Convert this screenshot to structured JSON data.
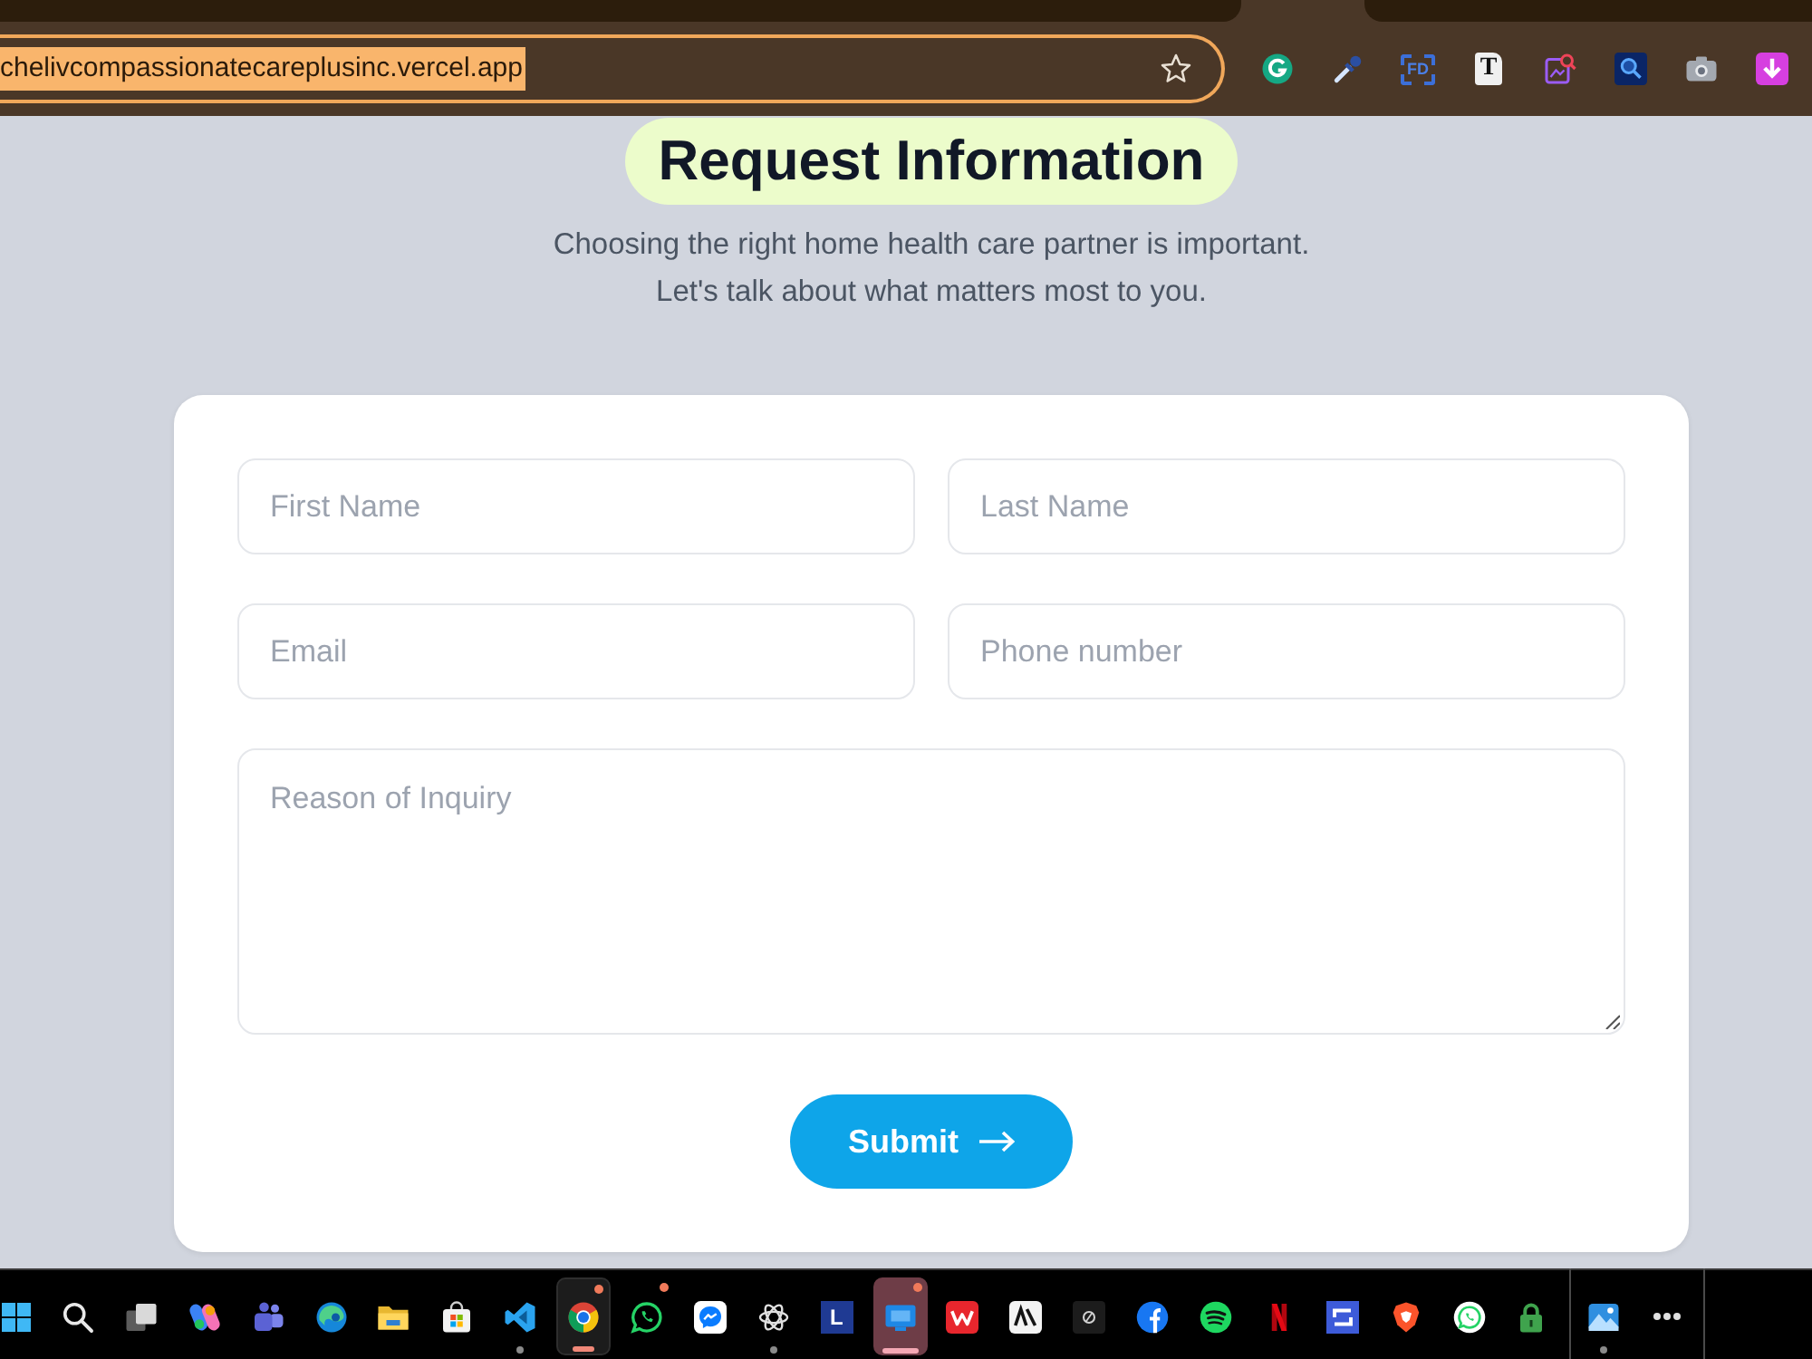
{
  "browser": {
    "address": {
      "url": "chelivcompassionatecareplusinc.vercel.app",
      "focused": true,
      "url_selected": true
    },
    "extension_labels": [
      "FD",
      "T"
    ]
  },
  "header": {
    "title": "Request Information",
    "subtitle_lines": [
      "Choosing the right home health care partner is important.",
      "Let's talk about what matters most to you."
    ]
  },
  "form": {
    "fields": [
      {
        "kind": "input",
        "placeholder": "First Name"
      },
      {
        "kind": "input",
        "placeholder": "Last Name"
      },
      {
        "kind": "input",
        "placeholder": "Email"
      },
      {
        "kind": "input",
        "placeholder": "Phone number"
      },
      {
        "kind": "textarea",
        "placeholder": "Reason of Inquiry"
      }
    ],
    "submit": {
      "label": "Submit"
    }
  },
  "taskbar": {
    "apps": [
      {
        "open": false,
        "selected": false,
        "attention": false,
        "notification": false
      },
      {
        "open": false,
        "selected": false,
        "attention": false,
        "notification": false
      },
      {
        "open": false,
        "selected": false,
        "attention": false,
        "notification": false
      },
      {
        "open": false,
        "selected": false,
        "attention": false,
        "notification": false
      },
      {
        "open": false,
        "selected": false,
        "attention": false,
        "notification": false
      },
      {
        "open": false,
        "selected": false,
        "attention": false,
        "notification": false
      },
      {
        "open": false,
        "selected": false,
        "attention": false,
        "notification": false
      },
      {
        "open": false,
        "selected": false,
        "attention": false,
        "notification": false
      },
      {
        "open": true,
        "selected": false,
        "attention": false,
        "notification": false
      },
      {
        "open": true,
        "selected": true,
        "attention": false,
        "notification": true
      },
      {
        "open": false,
        "selected": false,
        "attention": false,
        "notification": true
      },
      {
        "open": false,
        "selected": false,
        "attention": false,
        "notification": false
      },
      {
        "open": true,
        "selected": false,
        "attention": false,
        "notification": false
      },
      {
        "open": false,
        "selected": false,
        "attention": false,
        "notification": false,
        "label": "L"
      },
      {
        "open": true,
        "selected": false,
        "attention": true,
        "notification": true
      },
      {
        "open": false,
        "selected": false,
        "attention": false,
        "notification": false
      },
      {
        "open": false,
        "selected": false,
        "attention": false,
        "notification": false
      },
      {
        "open": false,
        "selected": false,
        "attention": false,
        "notification": false
      },
      {
        "open": false,
        "selected": false,
        "attention": false,
        "notification": false
      },
      {
        "open": false,
        "selected": false,
        "attention": false,
        "notification": false
      },
      {
        "open": false,
        "selected": false,
        "attention": false,
        "notification": false
      },
      {
        "open": false,
        "selected": false,
        "attention": false,
        "notification": false
      },
      {
        "open": false,
        "selected": false,
        "attention": false,
        "notification": false
      },
      {
        "open": false,
        "selected": false,
        "attention": false,
        "notification": false
      },
      {
        "open": false,
        "selected": false,
        "attention": false,
        "notification": false
      }
    ],
    "tray_apps": [
      {
        "open": true,
        "selected": false,
        "attention": false,
        "notification": false
      }
    ]
  }
}
